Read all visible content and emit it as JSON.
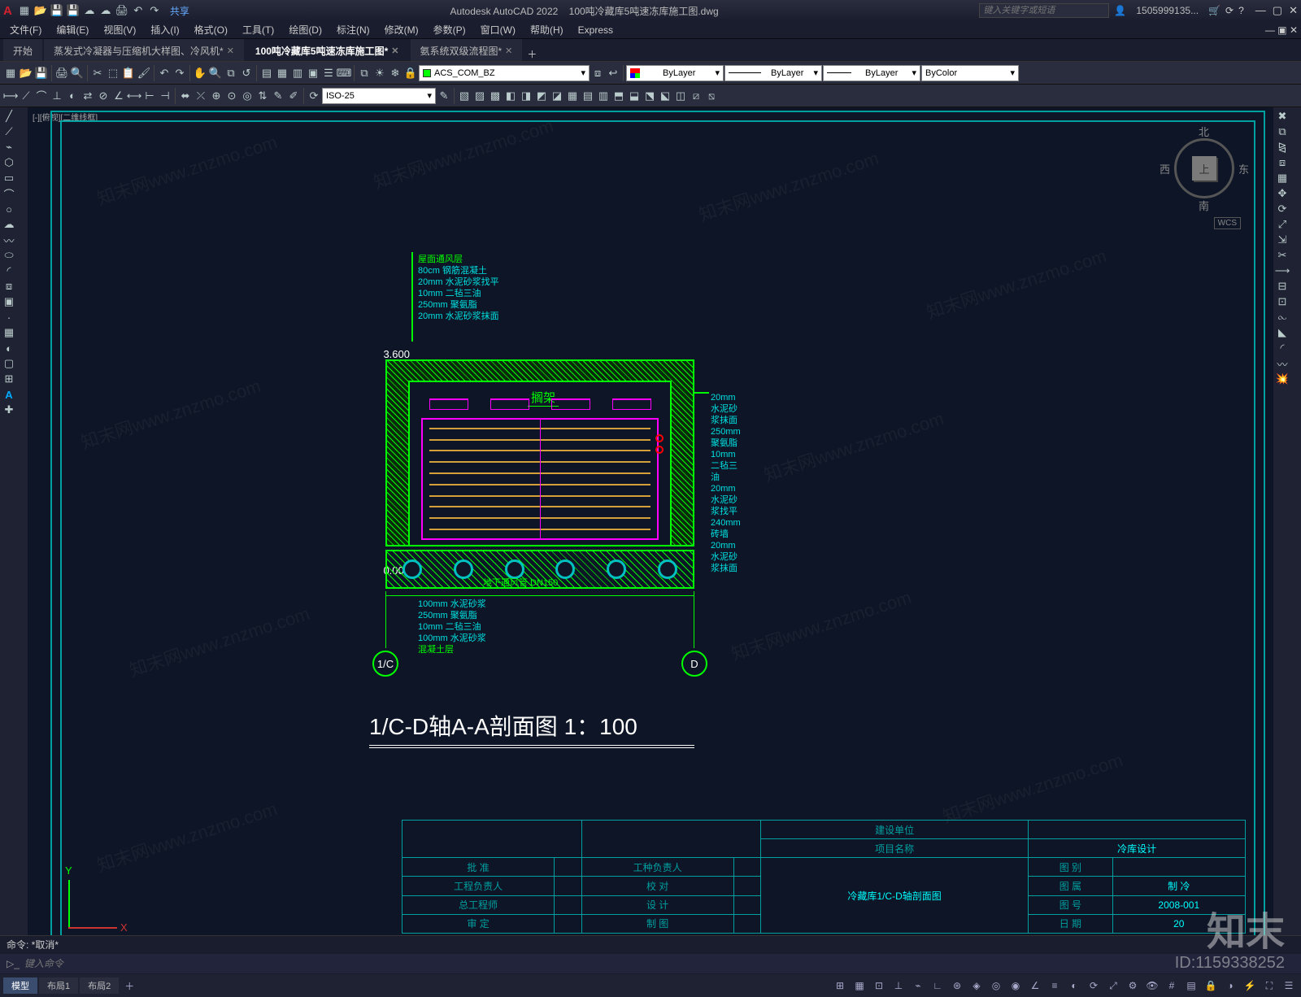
{
  "app": {
    "name": "Autodesk AutoCAD 2022",
    "filename": "100吨冷藏库5吨速冻库施工图.dwg",
    "share": "共享",
    "search_placeholder": "键入关键字或短语",
    "user": "1505999135...",
    "logo": "A"
  },
  "menubar": [
    "文件(F)",
    "编辑(E)",
    "视图(V)",
    "插入(I)",
    "格式(O)",
    "工具(T)",
    "绘图(D)",
    "标注(N)",
    "修改(M)",
    "参数(P)",
    "窗口(W)",
    "帮助(H)",
    "Express"
  ],
  "file_tabs": [
    {
      "label": "开始",
      "active": false
    },
    {
      "label": "蒸发式冷凝器与压缩机大样图、冷风机*",
      "active": false,
      "closable": true
    },
    {
      "label": "100吨冷藏库5吨速冻库施工图*",
      "active": true,
      "closable": true
    },
    {
      "label": "氨系统双级流程图*",
      "active": false,
      "closable": true
    }
  ],
  "layer": {
    "current": "ACS_COM_BZ",
    "bylayer": "ByLayer",
    "bycolor": "ByColor",
    "dimstyle": "ISO-25"
  },
  "view": {
    "label": "[-][俯视][二维线框]",
    "wcs": "WCS",
    "compass": {
      "n": "北",
      "s": "南",
      "e": "东",
      "w": "西",
      "top": "上"
    }
  },
  "drawing": {
    "title": "1/C-D轴A-A剖面图 1：100",
    "elev_top": "3.600",
    "elev_mid": "0.000",
    "axis_left": "1/C",
    "axis_right": "D",
    "shelf": "搁架",
    "duct": "地下通风管 DN150",
    "roof_layers": [
      "屋面通风层",
      "80cm  钢筋混凝土",
      "20mm  水泥砂浆找平",
      "10mm  二毡三油",
      "250mm 聚氨脂",
      "20mm  水泥砂浆抹面"
    ],
    "wall_layers": [
      "20mm  水泥砂浆抹面",
      "250mm 聚氨脂",
      "10mm  二毡三油",
      "20mm  水泥砂浆找平",
      "240mm 砖墙",
      "20mm  水泥砂浆抹面"
    ],
    "floor_layers": [
      "100mm 水泥砂浆",
      "250mm 聚氨脂",
      "10mm  二毡三油",
      "100mm 水泥砂浆",
      "混凝土层"
    ]
  },
  "titleblock": {
    "owner_l": "建设单位",
    "owner_v": "",
    "project_l": "项目名称",
    "project_v": "冷库设计",
    "approve": "批    准",
    "resp": "工种负责人",
    "pm": "工程负责人",
    "check": "校    对",
    "chief": "总工程师",
    "design": "设    计",
    "review": "审    定",
    "draw": "制    图",
    "sheet": "冷藏库1/C-D轴剖面图",
    "cat_l": "图    别",
    "cat_v": "",
    "belong_l": "图    属",
    "belong_v": "制    冷",
    "no_l": "图    号",
    "no_v": "2008-001",
    "date_l": "日    期",
    "date_v": "20"
  },
  "cmd": {
    "history": "命令: *取消*",
    "placeholder": "键入命令"
  },
  "status_tabs": [
    "模型",
    "布局1",
    "布局2"
  ],
  "watermark": {
    "text": "知末网www.znzmo.com",
    "big": "知末",
    "id": "ID:1159338252"
  },
  "ucs": {
    "x": "X",
    "y": "Y"
  }
}
